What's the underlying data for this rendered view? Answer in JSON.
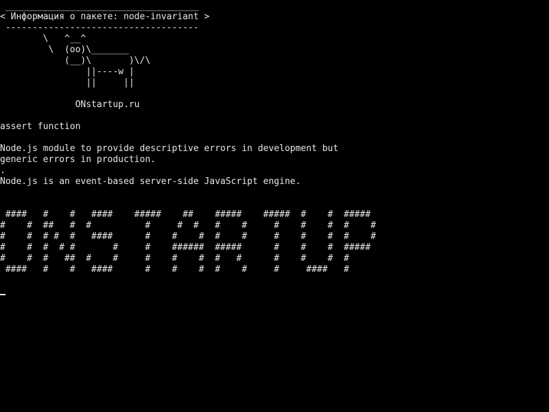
{
  "terminal": {
    "cow_top_border": " ____________________________________",
    "package_info": "< Информация о пакете: node-invariant >",
    "cow_bottom_border": " ------------------------------------",
    "cow": [
      "        \\   ^__^",
      "         \\  (oo)\\_______",
      "            (__)\\       )\\/\\",
      "                ||----w |",
      "                ||     ||"
    ],
    "site": "              ONstartup.ru",
    "description_title": "assert function",
    "description_lines": [
      "Node.js module to provide descriptive errors in development but",
      "generic errors in production.",
      ".",
      "Node.js is an event-based server-side JavaScript engine."
    ],
    "banner": [
      " ####   #    #   ####    #####    ##    #####    #####  #    #  #####",
      "#    #  ##   #  #          #     #  #   #    #     #    #    #  #    #",
      "#    #  # #  #   ####      #    #    #  #    #     #    #    #  #    #",
      "#    #  #  # #       #     #    ######  #####      #    #    #  #####",
      "#    #  #   ##  #    #     #    #    #  #   #      #    #    #  #",
      " ####   #    #   ####      #    #    #  #    #     #     ####   #"
    ],
    "colors": {
      "background": "#000000",
      "text": "#e8e8e8"
    }
  }
}
